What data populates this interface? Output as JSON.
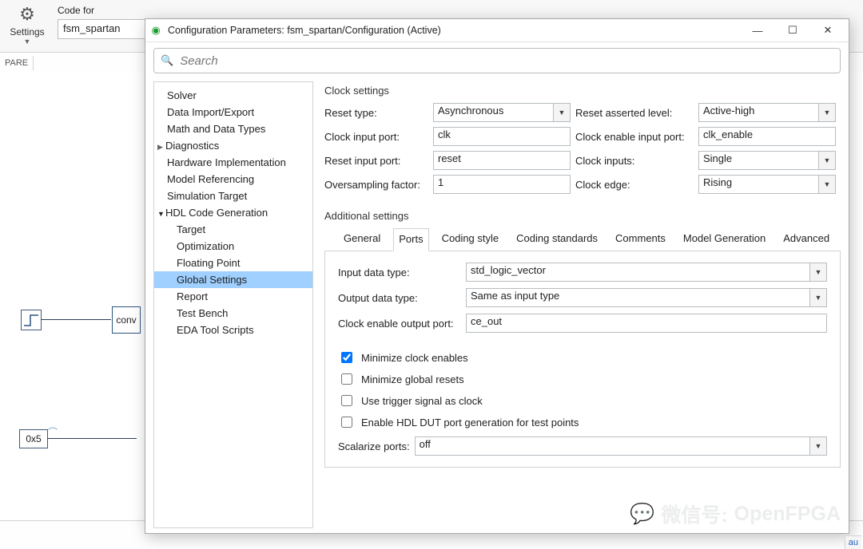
{
  "toolbar": {
    "settings": "Settings",
    "code_for": "Code for",
    "code_for_value": "fsm_spartan",
    "pare": "PARE"
  },
  "dialog": {
    "title": "Configuration Parameters: fsm_spartan/Configuration (Active)",
    "search_placeholder": "Search"
  },
  "tree": {
    "items": [
      "Solver",
      "Data Import/Export",
      "Math and Data Types",
      "Diagnostics",
      "Hardware Implementation",
      "Model Referencing",
      "Simulation Target",
      "HDL Code Generation"
    ],
    "hdl_children": [
      "Target",
      "Optimization",
      "Floating Point",
      "Global Settings",
      "Report",
      "Test Bench",
      "EDA Tool Scripts"
    ]
  },
  "clock": {
    "section": "Clock settings",
    "reset_type_lbl": "Reset type:",
    "reset_type": "Asynchronous",
    "reset_level_lbl": "Reset asserted level:",
    "reset_level": "Active-high",
    "clk_port_lbl": "Clock input port:",
    "clk_port": "clk",
    "clk_en_port_lbl": "Clock enable input port:",
    "clk_en_port": "clk_enable",
    "reset_port_lbl": "Reset input port:",
    "reset_port": "reset",
    "clk_inputs_lbl": "Clock inputs:",
    "clk_inputs": "Single",
    "oversamp_lbl": "Oversampling factor:",
    "oversamp": "1",
    "clk_edge_lbl": "Clock edge:",
    "clk_edge": "Rising"
  },
  "addl": {
    "section": "Additional settings",
    "tabs": [
      "General",
      "Ports",
      "Coding style",
      "Coding standards",
      "Comments",
      "Model Generation",
      "Advanced"
    ],
    "input_dt_lbl": "Input data type:",
    "input_dt": "std_logic_vector",
    "output_dt_lbl": "Output data type:",
    "output_dt": "Same as input type",
    "ce_out_lbl": "Clock enable output port:",
    "ce_out": "ce_out",
    "chk_min_ce": "Minimize clock enables",
    "chk_min_gr": "Minimize global resets",
    "chk_trig": "Use trigger signal as clock",
    "chk_dut": "Enable HDL DUT port generation for test points",
    "scal_lbl": "Scalarize ports:",
    "scal": "off"
  },
  "canvas": {
    "conv": "conv",
    "const": "0x5"
  },
  "watermark": {
    "label": "微信号:",
    "value": "OpenFPGA"
  },
  "au": "au"
}
